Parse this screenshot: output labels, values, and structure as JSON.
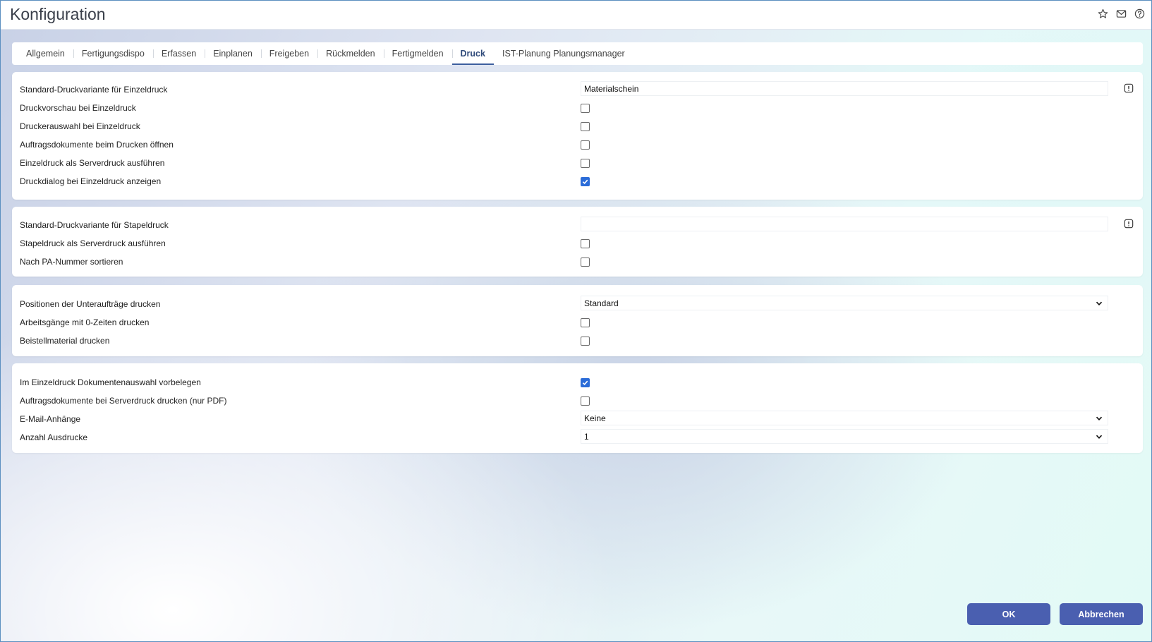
{
  "window": {
    "title": "Konfiguration",
    "icons": [
      "star-icon",
      "mail-icon",
      "help-icon"
    ]
  },
  "tabs": [
    {
      "label": "Allgemein"
    },
    {
      "label": "Fertigungsdispo"
    },
    {
      "label": "Erfassen"
    },
    {
      "label": "Einplanen"
    },
    {
      "label": "Freigeben"
    },
    {
      "label": "Rückmelden"
    },
    {
      "label": "Fertigmelden"
    },
    {
      "label": "Druck",
      "active": true
    },
    {
      "label": "IST-Planung Planungsmanager"
    }
  ],
  "einzeldruck": {
    "variante_label": "Standard-Druckvariante für Einzeldruck",
    "variante_value": "Materialschein",
    "vorschau_label": "Druckvorschau bei Einzeldruck",
    "vorschau_checked": false,
    "druckerauswahl_label": "Druckerauswahl bei Einzeldruck",
    "druckerauswahl_checked": false,
    "dokumente_oeffnen_label": "Auftragsdokumente beim Drucken öffnen",
    "dokumente_oeffnen_checked": false,
    "serverdruck_label": "Einzeldruck als Serverdruck ausführen",
    "serverdruck_checked": false,
    "druckdialog_label": "Druckdialog bei Einzeldruck anzeigen",
    "druckdialog_checked": true
  },
  "stapeldruck": {
    "variante_label": "Standard-Druckvariante für Stapeldruck",
    "variante_value": "",
    "serverdruck_label": "Stapeldruck als Serverdruck ausführen",
    "serverdruck_checked": false,
    "sortieren_label": "Nach PA-Nummer sortieren",
    "sortieren_checked": false
  },
  "positionen": {
    "unterauftraege_label": "Positionen der Unteraufträge drucken",
    "unterauftraege_value": "Standard",
    "nullzeiten_label": "Arbeitsgänge mit 0-Zeiten drucken",
    "nullzeiten_checked": false,
    "beistell_label": "Beistellmaterial drucken",
    "beistell_checked": false
  },
  "dokumente": {
    "vorbelegen_label": "Im Einzeldruck Dokumentenauswahl vorbelegen",
    "vorbelegen_checked": true,
    "serverdruck_pdf_label": "Auftragsdokumente bei Serverdruck drucken (nur PDF)",
    "serverdruck_pdf_checked": false,
    "email_label": "E-Mail-Anhänge",
    "email_value": "Keine",
    "anzahl_label": "Anzahl Ausdrucke",
    "anzahl_value": "1"
  },
  "buttons": {
    "ok_label": "OK",
    "cancel_label": "Abbrechen",
    "accent_color": "#4a5fb0"
  }
}
